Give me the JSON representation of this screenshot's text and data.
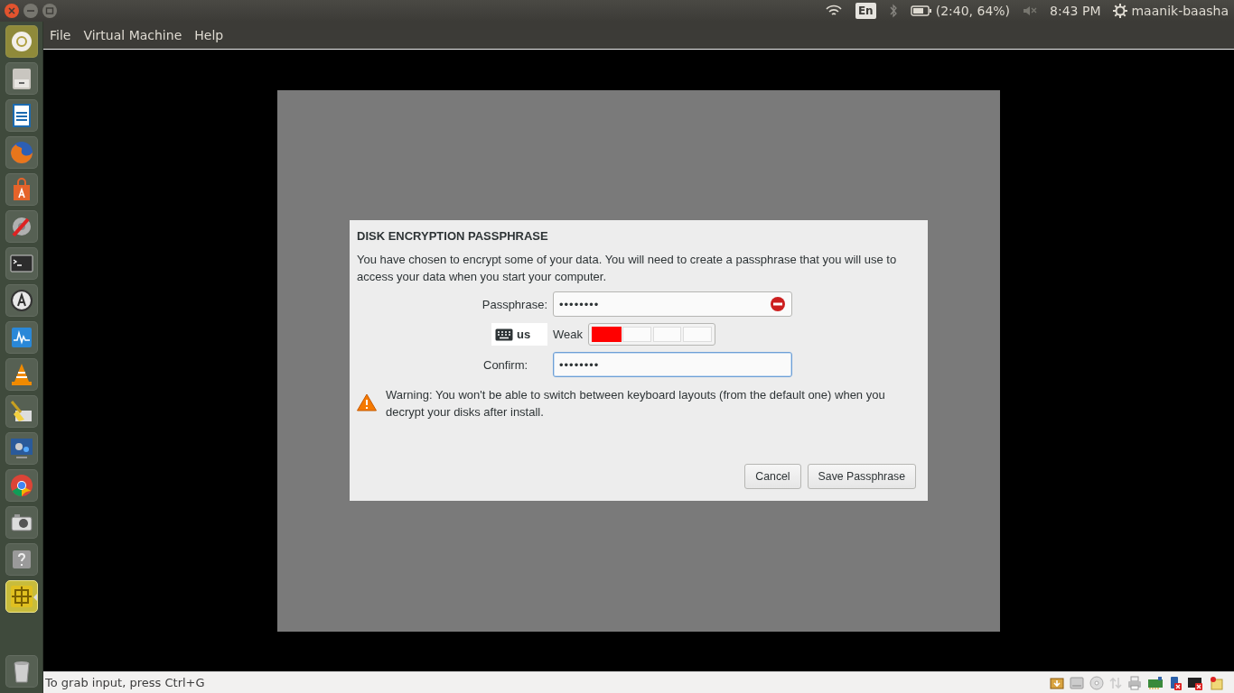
{
  "top_panel": {
    "keyboard_indicator": "En",
    "battery": "(2:40, 64%)",
    "clock": "8:43 PM",
    "user": "maanik-baasha"
  },
  "launcher": {
    "items": [
      {
        "kind": "home",
        "selected": false
      },
      {
        "kind": "files",
        "selected": false
      },
      {
        "kind": "writer",
        "selected": false
      },
      {
        "kind": "browser",
        "selected": false
      },
      {
        "kind": "store",
        "selected": false
      },
      {
        "kind": "settings",
        "selected": false
      },
      {
        "kind": "terminal",
        "selected": false
      },
      {
        "kind": "updater",
        "selected": false
      },
      {
        "kind": "monitor",
        "selected": false
      },
      {
        "kind": "cone",
        "selected": false
      },
      {
        "kind": "cleaner",
        "selected": false
      },
      {
        "kind": "media",
        "selected": false
      },
      {
        "kind": "chrome",
        "selected": false
      },
      {
        "kind": "camera",
        "selected": false
      },
      {
        "kind": "help",
        "selected": false
      },
      {
        "kind": "vm",
        "selected": true
      },
      {
        "kind": "trash",
        "selected": false
      }
    ]
  },
  "menu": [
    "File",
    "Virtual Machine",
    "Help"
  ],
  "dialog": {
    "title": "DISK ENCRYPTION PASSPHRASE",
    "description": "You have chosen to encrypt some of your data. You will need to create a passphrase that you will use to access your data when you start your computer.",
    "fields": [
      {
        "kind": "passphrase",
        "label": "Passphrase:",
        "value": "••••••••",
        "error": true,
        "focused": false
      },
      {
        "kind": "strength",
        "layout": "us",
        "strength": "Weak",
        "level": 0.25
      },
      {
        "kind": "passphrase",
        "label": "Confirm:",
        "value": "••••••••",
        "error": false,
        "focused": true
      }
    ],
    "warning": "Warning: You won't be able to switch between keyboard layouts (from the default one) when you decrypt your disks after install.",
    "buttons": [
      "Cancel",
      "Save Passphrase"
    ]
  },
  "status_bar": {
    "message": "To grab input, press Ctrl+G"
  }
}
